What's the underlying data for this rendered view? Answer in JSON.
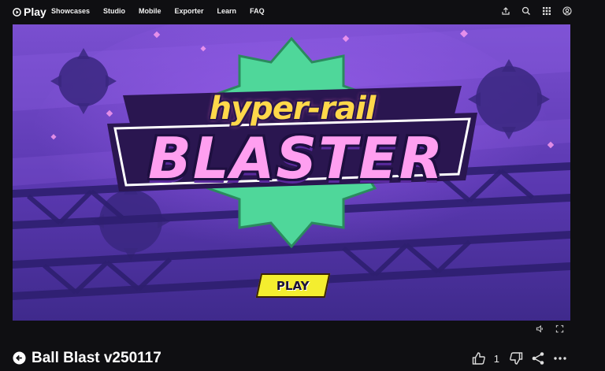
{
  "nav": {
    "brand": "Play",
    "menu": [
      "Showcases",
      "Studio",
      "Mobile",
      "Exporter",
      "Learn",
      "FAQ"
    ],
    "icons": [
      "share-icon",
      "search-icon",
      "apps-grid-icon",
      "account-icon"
    ]
  },
  "game": {
    "logo_line1": "hyper-rail",
    "logo_line2": "BLASTER",
    "play_label": "PLAY"
  },
  "stage_controls": {
    "icons": [
      "volume-icon",
      "fullscreen-icon"
    ]
  },
  "page": {
    "title": "Ball Blast v250117",
    "like_count": "1"
  },
  "colors": {
    "background": "#0f0f12",
    "stage_purple": "#4c2f9a",
    "accent_yellow": "#f4ee2f",
    "logo_green": "#4fd79a",
    "logo_pink": "#ff9ff0"
  }
}
